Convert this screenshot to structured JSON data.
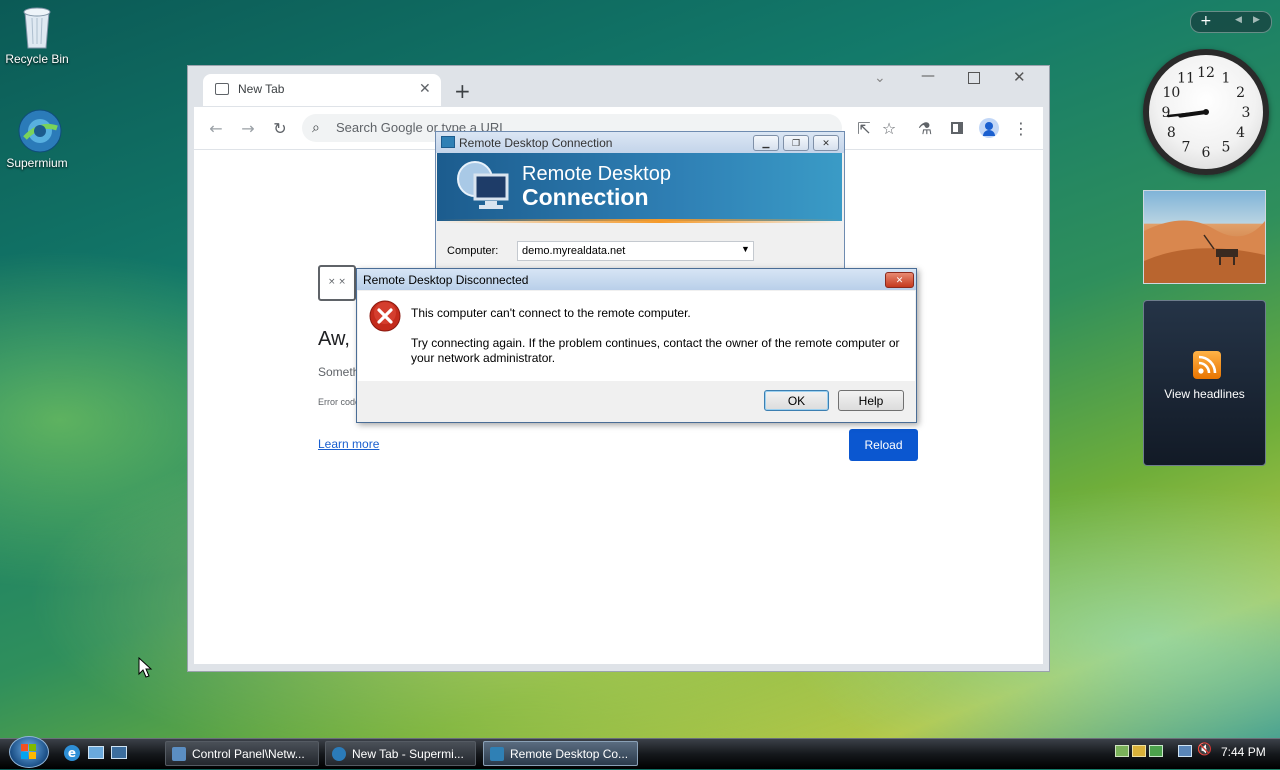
{
  "desktop": {
    "icons": [
      {
        "label": "Recycle Bin"
      },
      {
        "label": "Supermium"
      }
    ]
  },
  "browser": {
    "tab_title": "New Tab",
    "omnibox_placeholder": "Search Google or type a URL",
    "error_heading": "Aw,",
    "error_text": "Someth",
    "error_code": "Error code",
    "learn_more": "Learn more",
    "reload": "Reload"
  },
  "rdc": {
    "title": "Remote Desktop Connection",
    "banner_line1": "Remote Desktop",
    "banner_line2": "Connection",
    "computer_label": "Computer:",
    "computer_value": "demo.myrealdata.net"
  },
  "dialog": {
    "title": "Remote Desktop Disconnected",
    "message": "This computer can't connect to the remote computer.",
    "detail": "Try connecting again. If the problem continues, contact the owner of the remote computer or your network administrator.",
    "ok": "OK",
    "help": "Help"
  },
  "gadgets": {
    "clock": {
      "hour": 8,
      "minute": 44
    },
    "feeds_label": "View headlines"
  },
  "taskbar": {
    "tasks": [
      {
        "label": "Control Panel\\Netw..."
      },
      {
        "label": "New Tab - Supermi..."
      },
      {
        "label": "Remote Desktop Co..."
      }
    ],
    "time": "7:44 PM"
  }
}
